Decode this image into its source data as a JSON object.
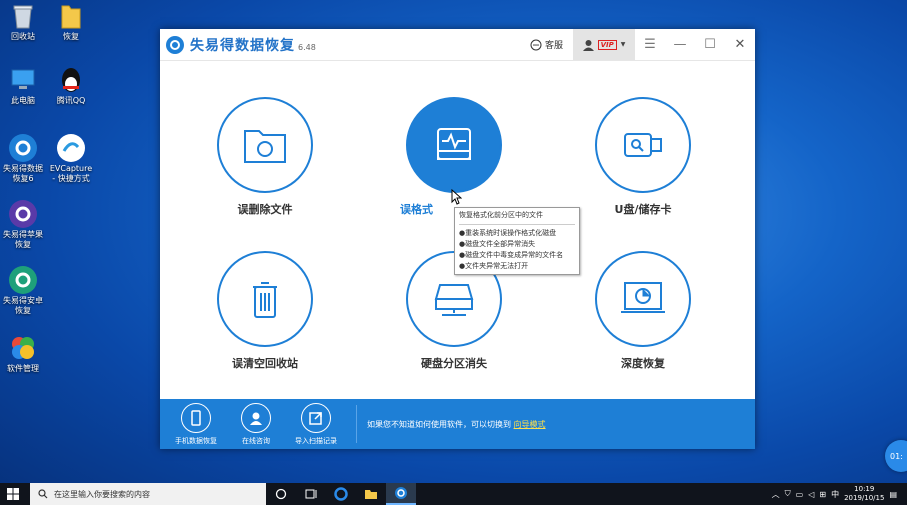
{
  "desktop": {
    "icons": [
      {
        "label": "回收站",
        "icon": "recycle-bin-icon"
      },
      {
        "label": "恢复",
        "icon": "folder-icon"
      },
      {
        "label": "此电脑",
        "icon": "computer-icon"
      },
      {
        "label": "腾讯QQ",
        "icon": "qq-icon"
      },
      {
        "label": "失易得数据恢复6",
        "icon": "recovery-app-icon"
      },
      {
        "label": "EVCapture - 快捷方式",
        "icon": "evcapture-icon"
      },
      {
        "label": "失易得苹果恢复",
        "icon": "apple-recovery-icon"
      },
      {
        "label": "失易得安卓恢复",
        "icon": "android-recovery-icon"
      },
      {
        "label": "软件管理",
        "icon": "software-manager-icon"
      }
    ]
  },
  "app": {
    "title": "失易得数据恢复",
    "version": "6.48",
    "kefu_label": "客服",
    "vip_label": "VIP",
    "features": [
      {
        "label": "误删除文件",
        "icon": "folder-recover-icon"
      },
      {
        "label": "误格式",
        "icon": "drive-format-icon"
      },
      {
        "label": "U盘/储存卡",
        "icon": "usb-drive-icon"
      },
      {
        "label": "误清空回收站",
        "icon": "trash-bin-icon"
      },
      {
        "label": "硬盘分区消失",
        "icon": "hard-disk-icon"
      },
      {
        "label": "深度恢复",
        "icon": "deep-scan-icon"
      }
    ],
    "tooltip": {
      "title": "恢复格式化前分区中的文件",
      "items": [
        "●重装系统时误操作格式化磁盘",
        "●磁盘文件全部异常消失",
        "●磁盘文件中毒变成异常的文件名",
        "●文件夹异常无法打开"
      ]
    },
    "bottom": {
      "buttons": [
        {
          "label": "手机数据恢复",
          "icon": "phone-icon"
        },
        {
          "label": "在线咨询",
          "icon": "person-icon"
        },
        {
          "label": "导入扫描记录",
          "icon": "import-icon"
        }
      ],
      "hint_text": "如果您不知道如何使用软件，可以切换到",
      "hint_link": "向导模式"
    }
  },
  "taskbar": {
    "search_placeholder": "在这里输入你要搜索的内容",
    "input_indicator": "中",
    "time": "10:19",
    "date": "2019/10/15"
  },
  "float_button": {
    "label": "01:"
  }
}
